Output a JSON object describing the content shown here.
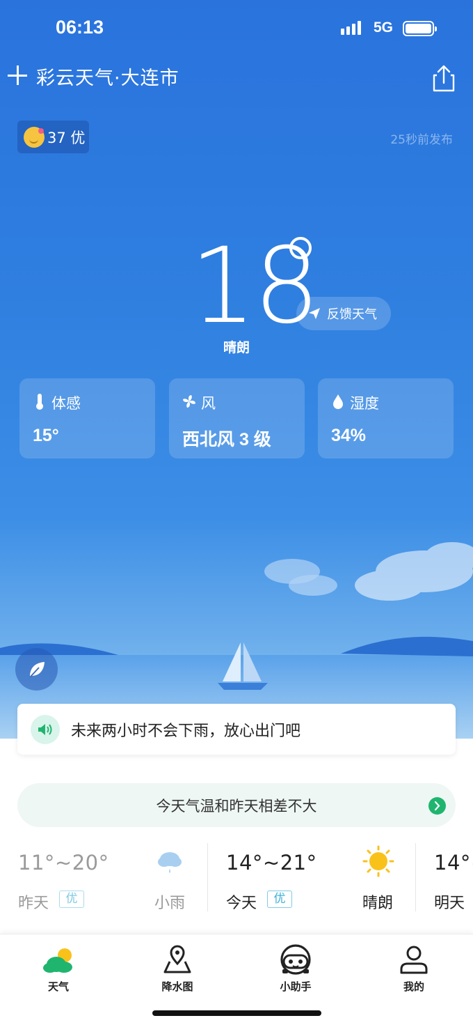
{
  "status_bar": {
    "time": "06:13",
    "network": "5G",
    "battery": "full"
  },
  "header": {
    "add_icon": "plus-icon",
    "title": "彩云天气·大连市",
    "share_icon": "share-icon"
  },
  "aqi": {
    "value_text": "37 优",
    "icon": "smiley-face-icon"
  },
  "published": "25秒前发布",
  "current": {
    "temperature": "18",
    "condition": "晴朗",
    "feedback_label": "反馈天气"
  },
  "cards": [
    {
      "label": "体感",
      "value": "15°",
      "icon": "thermometer-icon"
    },
    {
      "label": "风",
      "value": "西北风 3 级",
      "icon": "fan-icon"
    },
    {
      "label": "湿度",
      "value": "34%",
      "icon": "droplet-icon"
    }
  ],
  "rain_notice": "未来两小时不会下雨，放心出门吧",
  "compare_text": "今天气温和昨天相差不大",
  "days": [
    {
      "range": "11°~20°",
      "label": "昨天",
      "aqi": "优",
      "condition": "小雨",
      "icon": "rain-cloud-icon",
      "dim": true
    },
    {
      "range": "14°~21°",
      "label": "今天",
      "aqi": "优",
      "condition": "晴朗",
      "icon": "sun-icon",
      "dim": false
    },
    {
      "range": "14°~",
      "label": "明天",
      "dim": false
    }
  ],
  "tabs": [
    {
      "label": "天气",
      "icon": "weather-icon"
    },
    {
      "label": "降水图",
      "icon": "map-pin-icon"
    },
    {
      "label": "小助手",
      "icon": "assistant-robot-icon"
    },
    {
      "label": "我的",
      "icon": "user-icon"
    }
  ],
  "colors": {
    "accent_green": "#1fb56f",
    "aqi_badge": "#3cb0d8",
    "sky_top": "#2a73dd"
  }
}
